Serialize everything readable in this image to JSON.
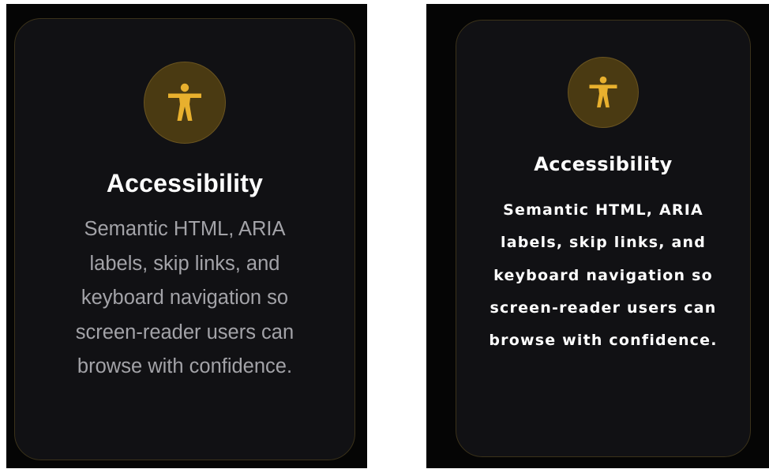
{
  "cards": {
    "left": {
      "icon": "accessibility-icon",
      "title": "Accessibility",
      "description": "Semantic HTML, ARIA labels, skip links, and keyboard navigation so screen-reader users can browse with confidence."
    },
    "right": {
      "icon": "accessibility-icon",
      "title": "Accessibility",
      "description": "Semantic HTML, ARIA labels, skip links, and keyboard navigation so screen-reader users can browse with confidence."
    }
  },
  "colors": {
    "panel_background": "#050505",
    "card_background": "#111114",
    "card_border": "#3b321a",
    "accent_gold": "#e8b02e",
    "icon_circle_background": "#4a3a12",
    "title_text": "#ffffff",
    "left_description_text": "#a3a3a8",
    "right_description_text": "#ffffff"
  }
}
